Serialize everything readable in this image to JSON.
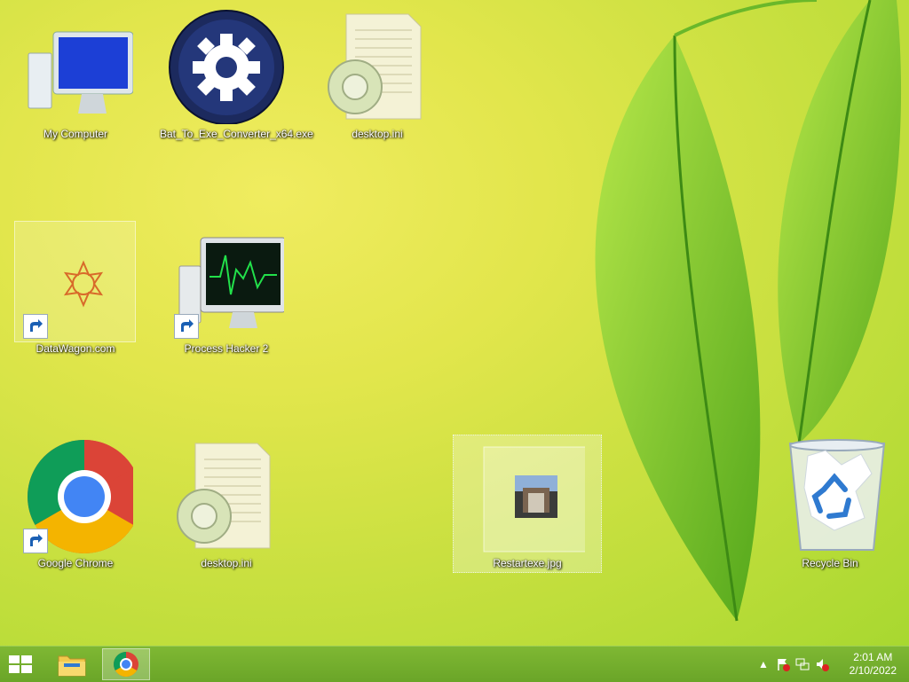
{
  "desktop": {
    "icons": [
      {
        "label": "My Computer",
        "icon": "computer-icon"
      },
      {
        "label": "Bat_To_Exe_Converter_x64.exe",
        "icon": "gear-app-icon"
      },
      {
        "label": "desktop.ini",
        "icon": "config-file-icon"
      },
      {
        "label": "DataWagon.com",
        "icon": "web-shortcut-icon"
      },
      {
        "label": "Process Hacker 2",
        "icon": "process-monitor-icon"
      },
      {
        "label": "Google Chrome",
        "icon": "chrome-icon"
      },
      {
        "label": "desktop.ini",
        "icon": "config-file-icon"
      },
      {
        "label": "Restartexe.jpg",
        "icon": "image-file-icon"
      },
      {
        "label": "Recycle Bin",
        "icon": "recycle-bin-icon"
      }
    ]
  },
  "taskbar": {
    "pinned": [
      {
        "name": "File Explorer",
        "icon": "folder-icon"
      },
      {
        "name": "Google Chrome",
        "icon": "chrome-icon"
      }
    ],
    "tray": {
      "time": "2:01 AM",
      "date": "2/10/2022"
    }
  },
  "colors": {
    "taskbar": "#6aa528",
    "wallpaper": "#e2e64c"
  }
}
